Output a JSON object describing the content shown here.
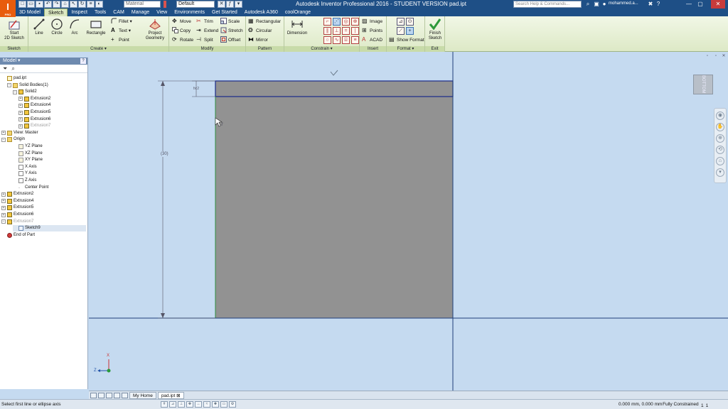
{
  "app": {
    "logo_text": "I",
    "logo_sub": "PRO",
    "title": "Autodesk Inventor Professional 2016 - STUDENT VERSION    pad.ipt",
    "material": "Material",
    "appearance": "Default",
    "search_placeholder": "Search Help & Commands...",
    "user": "mohammed.a...",
    "minimize": "—",
    "maximize": "▢",
    "close": "✕"
  },
  "tabs": [
    "3D Model",
    "Sketch",
    "Inspect",
    "Tools",
    "CAM",
    "Manage",
    "View",
    "Environments",
    "Get Started",
    "Autodesk A360",
    "coolOrange"
  ],
  "active_tab": "Sketch",
  "ribbon": {
    "sketch_panel": {
      "title": "Sketch",
      "start_line1": "Start",
      "start_line2": "2D Sketch"
    },
    "create_panel": {
      "title": "Create ▾",
      "line": "Line",
      "circle": "Circle",
      "arc": "Arc",
      "rectangle": "Rectangle",
      "fillet": "Fillet",
      "text": "Text",
      "point": "Point",
      "project_line1": "Project",
      "project_line2": "Geometry"
    },
    "modify_panel": {
      "title": "Modify",
      "move": "Move",
      "copy": "Copy",
      "rotate": "Rotate",
      "trim": "Trim",
      "extend": "Extend",
      "split": "Split",
      "scale": "Scale",
      "stretch": "Stretch",
      "offset": "Offset"
    },
    "pattern_panel": {
      "title": "Pattern",
      "rectangular": "Rectangular",
      "circular": "Circular",
      "mirror": "Mirror"
    },
    "constrain_panel": {
      "title": "Constrain ▾",
      "dimension": "Dimension"
    },
    "insert_panel": {
      "title": "Insert",
      "image": "Image",
      "points": "Points",
      "acad": "ACAD"
    },
    "format_panel": {
      "title": "Format ▾",
      "show_format": "Show Format"
    },
    "exit_panel": {
      "title": "Exit",
      "finish_line1": "Finish",
      "finish_line2": "Sketch"
    }
  },
  "browser": {
    "header": "Model ▾",
    "help": "?",
    "tree": [
      {
        "label": "pad.ipt",
        "depth": 0,
        "icon": "doc",
        "exp": ""
      },
      {
        "label": "Solid Bodies(1)",
        "depth": 1,
        "icon": "folder",
        "exp": "−"
      },
      {
        "label": "Solid2",
        "depth": 2,
        "icon": "solid",
        "exp": "−"
      },
      {
        "label": "Extrusion2",
        "depth": 3,
        "icon": "solid",
        "exp": "+"
      },
      {
        "label": "Extrusion4",
        "depth": 3,
        "icon": "solid",
        "exp": "+"
      },
      {
        "label": "Extrusion5",
        "depth": 3,
        "icon": "solid",
        "exp": "+"
      },
      {
        "label": "Extrusion6",
        "depth": 3,
        "icon": "solid",
        "exp": "+"
      },
      {
        "label": "Extrusion7",
        "depth": 3,
        "icon": "solid",
        "exp": "+",
        "dim": true
      },
      {
        "label": "View: Master",
        "depth": 0,
        "icon": "folder",
        "exp": "+"
      },
      {
        "label": "Origin",
        "depth": 0,
        "icon": "folder",
        "exp": "−"
      },
      {
        "label": "YZ Plane",
        "depth": 2,
        "icon": "plane",
        "exp": ""
      },
      {
        "label": "XZ Plane",
        "depth": 2,
        "icon": "plane",
        "exp": ""
      },
      {
        "label": "XY Plane",
        "depth": 2,
        "icon": "plane",
        "exp": ""
      },
      {
        "label": "X Axis",
        "depth": 2,
        "icon": "axis",
        "exp": ""
      },
      {
        "label": "Y Axis",
        "depth": 2,
        "icon": "axis",
        "exp": ""
      },
      {
        "label": "Z Axis",
        "depth": 2,
        "icon": "axis",
        "exp": ""
      },
      {
        "label": "Center Point",
        "depth": 2,
        "icon": "pt",
        "exp": ""
      },
      {
        "label": "Extrusion2",
        "depth": 0,
        "icon": "solid",
        "exp": "+"
      },
      {
        "label": "Extrusion4",
        "depth": 0,
        "icon": "solid",
        "exp": "+"
      },
      {
        "label": "Extrusion5",
        "depth": 0,
        "icon": "solid",
        "exp": "+"
      },
      {
        "label": "Extrusion6",
        "depth": 0,
        "icon": "solid",
        "exp": "+"
      },
      {
        "label": "Extrusion7",
        "depth": 0,
        "icon": "solid",
        "exp": "−",
        "dim": true
      },
      {
        "label": "Sketch9",
        "depth": 2,
        "icon": "sketch",
        "exp": "",
        "hl": true
      },
      {
        "label": "End of Part",
        "depth": 0,
        "icon": "end",
        "exp": ""
      }
    ]
  },
  "canvas": {
    "dim_vertical": "(30)",
    "dim_small": "fx:2",
    "viewcube": "BOTTOM",
    "axis_x": "X",
    "axis_z": "Z",
    "colors": {
      "bg": "#c5daf0",
      "part": "#929292",
      "sketch_edge": "#1c2a8a",
      "axis_line": "#1e3f7a",
      "green": "#2f8f3f"
    }
  },
  "doc_tabs": {
    "home": "My Home",
    "file": "pad.ipt",
    "close": "⊠"
  },
  "status": {
    "message": "Select first line or ellipse axis",
    "coords": "0.000 mm, 0.000 mm",
    "constraint": "Fully Constrained",
    "count1": "1",
    "count2": "1"
  }
}
